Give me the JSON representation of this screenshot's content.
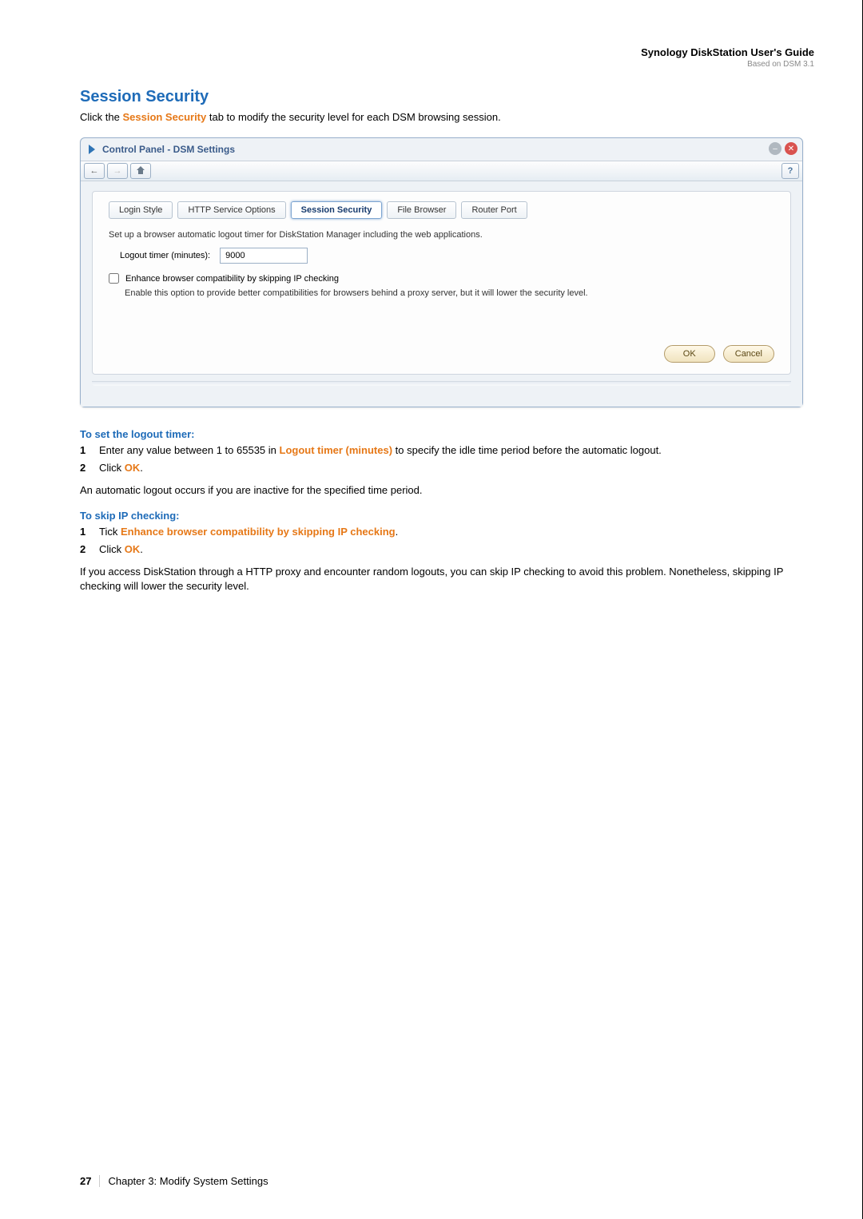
{
  "header": {
    "title": "Synology DiskStation User's Guide",
    "sub": "Based on DSM 3.1"
  },
  "section": {
    "title": "Session Security",
    "intro_pre": "Click the ",
    "intro_bold": "Session Security",
    "intro_post": " tab to modify the security level for each DSM browsing session."
  },
  "window": {
    "title": "Control Panel - DSM Settings",
    "help": "?",
    "tabs": {
      "login_style": "Login Style",
      "http_opts": "HTTP Service Options",
      "session_security": "Session Security",
      "file_browser": "File Browser",
      "router_port": "Router Port"
    },
    "desc": "Set up a browser automatic logout timer for DiskStation Manager including the web applications.",
    "logout_label": "Logout timer (minutes):",
    "logout_value": "9000",
    "cb_label": "Enhance browser compatibility by skipping IP checking",
    "cb_desc": "Enable this option to provide better compatibilities for browsers behind a proxy server, but it will lower the security level.",
    "ok": "OK",
    "cancel": "Cancel"
  },
  "instructions": {
    "set_timer_heading": "To set the logout timer:",
    "step1_pre": "Enter any value between 1 to 65535 in ",
    "step1_bold": "Logout timer (minutes)",
    "step1_post": " to specify the idle time period before the automatic logout.",
    "step2_pre": "Click ",
    "step2_bold": "OK",
    "step2_post": ".",
    "auto_logout_para": "An automatic logout occurs if you are inactive for the specified time period.",
    "skip_ip_heading": "To skip IP checking:",
    "skip_step1_pre": "Tick ",
    "skip_step1_bold": "Enhance browser compatibility by skipping IP checking",
    "skip_step1_post": ".",
    "skip_step2_pre": "Click ",
    "skip_step2_bold": "OK",
    "skip_step2_post": ".",
    "skip_para": "If you access DiskStation through a HTTP proxy and encounter random logouts, you can skip IP checking to avoid this problem. Nonetheless, skipping IP checking will lower the security level."
  },
  "footer": {
    "page": "27",
    "chapter": "Chapter 3: Modify System Settings"
  },
  "numbers": {
    "one": "1",
    "two": "2"
  }
}
